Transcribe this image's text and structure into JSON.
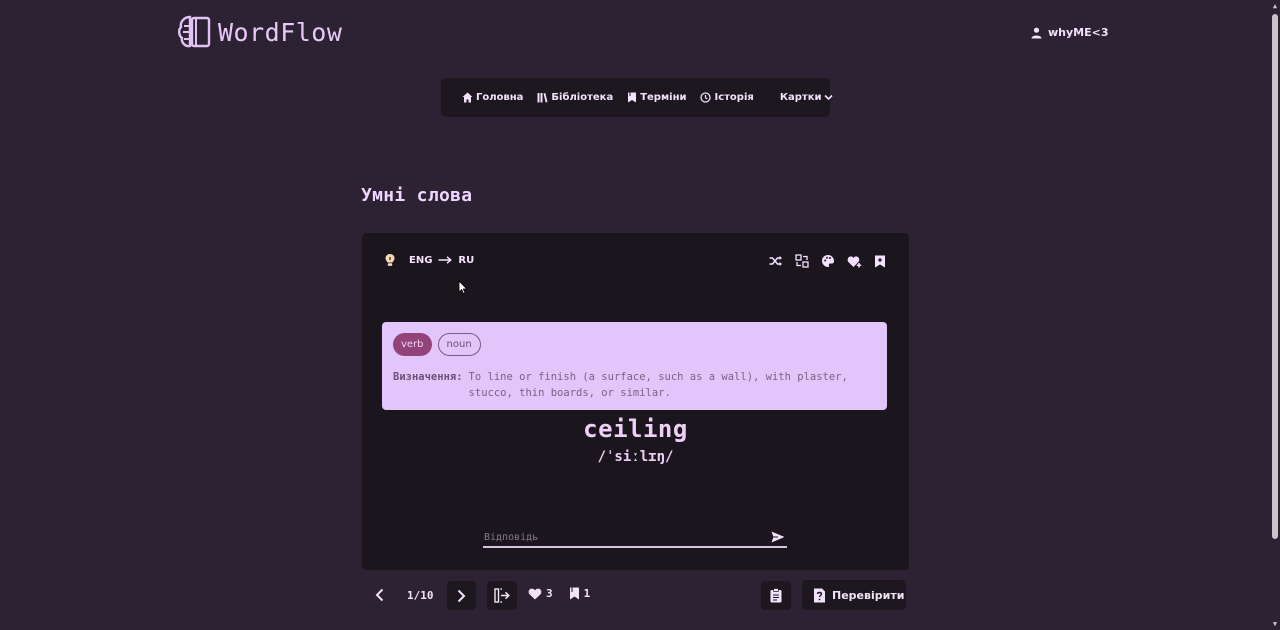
{
  "app": {
    "name": "WordFlow"
  },
  "user": {
    "name": "whyME<3"
  },
  "nav": {
    "items": [
      {
        "label": "Головна",
        "icon": "home-icon"
      },
      {
        "label": "Бібліотека",
        "icon": "library-icon"
      },
      {
        "label": "Терміни",
        "icon": "bookmark-icon"
      },
      {
        "label": "Історія",
        "icon": "history-icon"
      }
    ],
    "dropdown": {
      "label": "Картки",
      "icon": "chevron-down-icon"
    }
  },
  "section": {
    "title": "Умні слова"
  },
  "card": {
    "direction": {
      "from": "ENG",
      "to": "RU"
    },
    "tools": [
      "shuffle-icon",
      "swap-icon",
      "palette-icon",
      "heart-plus-icon",
      "bookmark-plus-icon"
    ],
    "tags": [
      "verb",
      "noun"
    ],
    "definition_label": "Визначення:",
    "definition": "To line or finish (a surface, such as a wall), with plaster, stucco, thin boards, or similar.",
    "word": "ceiling",
    "transcription": "/ˈsiːlɪŋ/",
    "answer": {
      "placeholder": "Відповідь",
      "value": ""
    }
  },
  "footer": {
    "counter": "1/10",
    "likes": "3",
    "saved": "1",
    "check_label": "Перевірити"
  },
  "colors": {
    "background": "#2c2233",
    "card": "#1b151e",
    "definition_box": "#e2c5fb",
    "accent": "#92437a"
  }
}
